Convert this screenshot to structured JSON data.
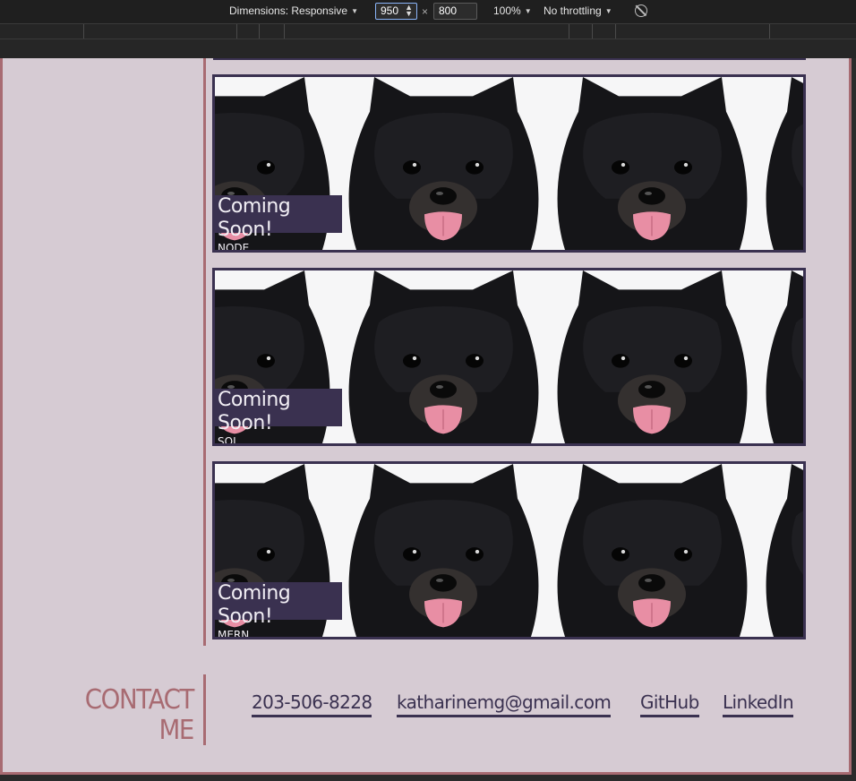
{
  "devtools": {
    "dimensions_label": "Dimensions: Responsive",
    "width_value": "950",
    "times": "×",
    "height_value": "800",
    "zoom": "100%",
    "throttling": "No throttling",
    "rotate_icon": "rotate-icon"
  },
  "projects": [
    {
      "title": "Coming Soon!",
      "subtitle": "NODE"
    },
    {
      "title": "Coming Soon!",
      "subtitle": "SQL"
    },
    {
      "title": "Coming Soon!",
      "subtitle": "MERN"
    }
  ],
  "contact": {
    "title_line1": "CONTACT",
    "title_line2": "ME",
    "links": [
      {
        "label": "203-506-8228"
      },
      {
        "label": "katharinemg@gmail.com"
      },
      {
        "label": "GitHub"
      },
      {
        "label": "LinkedIn"
      }
    ]
  },
  "colors": {
    "background": "#d6cbd3",
    "accent_rose": "#a86b72",
    "accent_purple": "#3a3150"
  }
}
